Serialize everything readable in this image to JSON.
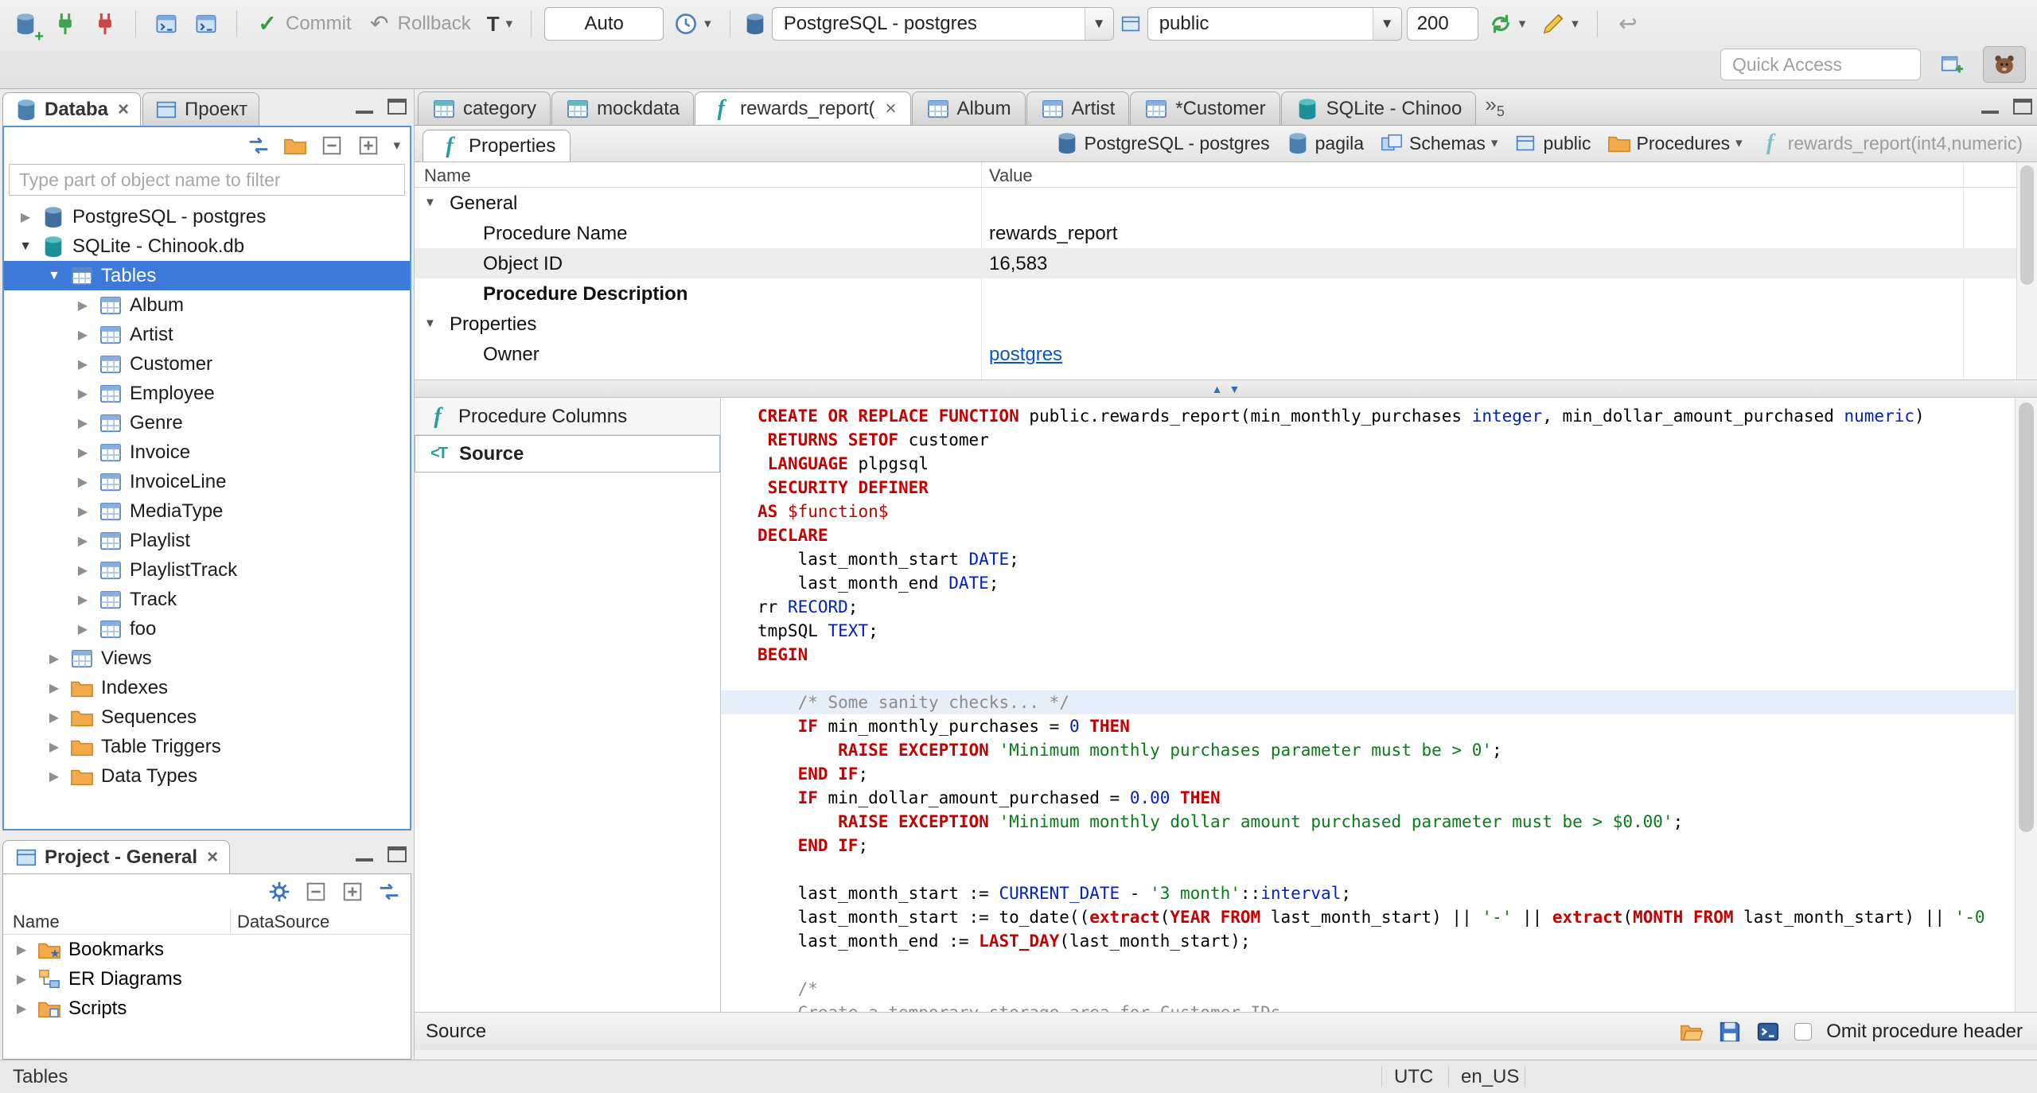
{
  "toolbar": {
    "commit_label": "Commit",
    "rollback_label": "Rollback",
    "txn_letter": "T",
    "auto_value": "Auto",
    "connection_value": "PostgreSQL - postgres",
    "schema_value": "public",
    "fetch_size": "200",
    "quick_access_placeholder": "Quick Access"
  },
  "navigator": {
    "tabs": [
      {
        "label": "Databa",
        "active": true,
        "icon": "db-plain"
      },
      {
        "label": "Проект",
        "active": false,
        "icon": "projects"
      }
    ],
    "filter_placeholder": "Type part of object name to filter",
    "tree": [
      {
        "label": "PostgreSQL - postgres",
        "indent": 0,
        "tw": "right",
        "icon": "db-pg"
      },
      {
        "label": "SQLite - Chinook.db",
        "indent": 0,
        "tw": "down",
        "icon": "db-teal"
      },
      {
        "label": "Tables",
        "indent": 1,
        "tw": "down",
        "icon": "tables",
        "selected": true
      },
      {
        "label": "Album",
        "indent": 2,
        "tw": "right",
        "icon": "table"
      },
      {
        "label": "Artist",
        "indent": 2,
        "tw": "right",
        "icon": "table"
      },
      {
        "label": "Customer",
        "indent": 2,
        "tw": "right",
        "icon": "table"
      },
      {
        "label": "Employee",
        "indent": 2,
        "tw": "right",
        "icon": "table"
      },
      {
        "label": "Genre",
        "indent": 2,
        "tw": "right",
        "icon": "table"
      },
      {
        "label": "Invoice",
        "indent": 2,
        "tw": "right",
        "icon": "table"
      },
      {
        "label": "InvoiceLine",
        "indent": 2,
        "tw": "right",
        "icon": "table"
      },
      {
        "label": "MediaType",
        "indent": 2,
        "tw": "right",
        "icon": "table"
      },
      {
        "label": "Playlist",
        "indent": 2,
        "tw": "right",
        "icon": "table"
      },
      {
        "label": "PlaylistTrack",
        "indent": 2,
        "tw": "right",
        "icon": "table"
      },
      {
        "label": "Track",
        "indent": 2,
        "tw": "right",
        "icon": "table"
      },
      {
        "label": "foo",
        "indent": 2,
        "tw": "right",
        "icon": "table"
      },
      {
        "label": "Views",
        "indent": 1,
        "tw": "right",
        "icon": "views"
      },
      {
        "label": "Indexes",
        "indent": 1,
        "tw": "right",
        "icon": "folder"
      },
      {
        "label": "Sequences",
        "indent": 1,
        "tw": "right",
        "icon": "folder"
      },
      {
        "label": "Table Triggers",
        "indent": 1,
        "tw": "right",
        "icon": "folder"
      },
      {
        "label": "Data Types",
        "indent": 1,
        "tw": "right",
        "icon": "folder"
      }
    ]
  },
  "project_panel": {
    "title": "Project - General",
    "columns": [
      "Name",
      "DataSource"
    ],
    "items": [
      {
        "label": "Bookmarks",
        "icon": "folder-star"
      },
      {
        "label": "ER Diagrams",
        "icon": "diagram"
      },
      {
        "label": "Scripts",
        "icon": "folder-script"
      }
    ]
  },
  "editor": {
    "tabs": [
      {
        "label": "category",
        "icon": "table-teal"
      },
      {
        "label": "mockdata",
        "icon": "table-teal"
      },
      {
        "label": "rewards_report(",
        "icon": "function",
        "active": true,
        "closable": true
      },
      {
        "label": "Album",
        "icon": "table"
      },
      {
        "label": "Artist",
        "icon": "table"
      },
      {
        "label": "*Customer",
        "icon": "table"
      },
      {
        "label": "SQLite - Chinoo",
        "icon": "db-teal"
      }
    ],
    "overflow_count": "5",
    "properties_tab_label": "Properties",
    "breadcrumbs": [
      {
        "label": "PostgreSQL - postgres",
        "icon": "db-pg"
      },
      {
        "label": "pagila",
        "icon": "db-plain"
      },
      {
        "label": "Schemas",
        "icon": "schemas",
        "dropdown": true
      },
      {
        "label": "public",
        "icon": "schema"
      },
      {
        "label": "Procedures",
        "icon": "folder",
        "dropdown": true
      },
      {
        "label": "rewards_report(int4,numeric)",
        "icon": "function",
        "muted": true
      }
    ],
    "grid": {
      "name_header": "Name",
      "value_header": "Value",
      "rows": [
        {
          "kind": "group",
          "name": "General"
        },
        {
          "kind": "prop",
          "name": "Procedure Name",
          "value": "rewards_report"
        },
        {
          "kind": "prop",
          "name": "Object ID",
          "value": "16,583",
          "shaded": true
        },
        {
          "kind": "prop",
          "name": "Procedure Description",
          "bold": true
        },
        {
          "kind": "group",
          "name": "Properties"
        },
        {
          "kind": "prop",
          "name": "Owner",
          "value": "postgres",
          "link": true
        }
      ]
    },
    "side_tabs": [
      {
        "label": "Procedure Columns",
        "icon": "function"
      },
      {
        "label": "Source",
        "icon": "source",
        "selected": true
      }
    ],
    "bottom": {
      "left_label": "Source",
      "checkbox_label": "Omit procedure header"
    }
  },
  "code": {
    "lines": [
      {
        "seg": [
          [
            "k",
            "CREATE OR REPLACE FUNCTION"
          ],
          [
            "p",
            " public.rewards_report(min_monthly_purchases "
          ],
          [
            "t",
            "integer"
          ],
          [
            "p",
            ", min_dollar_amount_purchased "
          ],
          [
            "t",
            "numeric"
          ],
          [
            "p",
            ")"
          ]
        ]
      },
      {
        "seg": [
          [
            "p",
            " "
          ],
          [
            "k",
            "RETURNS SETOF"
          ],
          [
            "p",
            " customer"
          ]
        ]
      },
      {
        "seg": [
          [
            "p",
            " "
          ],
          [
            "k",
            "LANGUAGE"
          ],
          [
            "p",
            " plpgsql"
          ]
        ]
      },
      {
        "seg": [
          [
            "p",
            " "
          ],
          [
            "k",
            "SECURITY DEFINER"
          ]
        ]
      },
      {
        "seg": [
          [
            "k",
            "AS"
          ],
          [
            "p",
            " "
          ],
          [
            "d",
            "$function$"
          ]
        ]
      },
      {
        "seg": [
          [
            "k",
            "DECLARE"
          ]
        ]
      },
      {
        "seg": [
          [
            "p",
            "    last_month_start "
          ],
          [
            "t",
            "DATE"
          ],
          [
            "p",
            ";"
          ]
        ]
      },
      {
        "seg": [
          [
            "p",
            "    last_month_end "
          ],
          [
            "t",
            "DATE"
          ],
          [
            "p",
            ";"
          ]
        ]
      },
      {
        "seg": [
          [
            "p",
            "rr "
          ],
          [
            "t",
            "RECORD"
          ],
          [
            "p",
            ";"
          ]
        ]
      },
      {
        "seg": [
          [
            "p",
            "tmpSQL "
          ],
          [
            "t",
            "TEXT"
          ],
          [
            "p",
            ";"
          ]
        ]
      },
      {
        "seg": [
          [
            "k",
            "BEGIN"
          ]
        ]
      },
      {
        "seg": []
      },
      {
        "hl": true,
        "seg": [
          [
            "p",
            "    "
          ],
          [
            "c",
            "/* Some sanity checks... */"
          ]
        ]
      },
      {
        "seg": [
          [
            "p",
            "    "
          ],
          [
            "k",
            "IF"
          ],
          [
            "p",
            " min_monthly_purchases = "
          ],
          [
            "n",
            "0"
          ],
          [
            "p",
            " "
          ],
          [
            "k",
            "THEN"
          ]
        ]
      },
      {
        "seg": [
          [
            "p",
            "        "
          ],
          [
            "k",
            "RAISE EXCEPTION"
          ],
          [
            "p",
            " "
          ],
          [
            "s",
            "'Minimum monthly purchases parameter must be > 0'"
          ],
          [
            "p",
            ";"
          ]
        ]
      },
      {
        "seg": [
          [
            "p",
            "    "
          ],
          [
            "k",
            "END IF"
          ],
          [
            "p",
            ";"
          ]
        ]
      },
      {
        "seg": [
          [
            "p",
            "    "
          ],
          [
            "k",
            "IF"
          ],
          [
            "p",
            " min_dollar_amount_purchased = "
          ],
          [
            "n",
            "0.00"
          ],
          [
            "p",
            " "
          ],
          [
            "k",
            "THEN"
          ]
        ]
      },
      {
        "seg": [
          [
            "p",
            "        "
          ],
          [
            "k",
            "RAISE EXCEPTION"
          ],
          [
            "p",
            " "
          ],
          [
            "s",
            "'Minimum monthly dollar amount purchased parameter must be > $0.00'"
          ],
          [
            "p",
            ";"
          ]
        ]
      },
      {
        "seg": [
          [
            "p",
            "    "
          ],
          [
            "k",
            "END IF"
          ],
          [
            "p",
            ";"
          ]
        ]
      },
      {
        "seg": []
      },
      {
        "seg": [
          [
            "p",
            "    last_month_start := "
          ],
          [
            "t",
            "CURRENT_DATE"
          ],
          [
            "p",
            " - "
          ],
          [
            "s",
            "'3 month'"
          ],
          [
            "p",
            "::"
          ],
          [
            "t",
            "interval"
          ],
          [
            "p",
            ";"
          ]
        ]
      },
      {
        "seg": [
          [
            "p",
            "    last_month_start := to_date(("
          ],
          [
            "k",
            "extract"
          ],
          [
            "p",
            "("
          ],
          [
            "k",
            "YEAR FROM"
          ],
          [
            "p",
            " last_month_start) || "
          ],
          [
            "s",
            "'-'"
          ],
          [
            "p",
            " || "
          ],
          [
            "k",
            "extract"
          ],
          [
            "p",
            "("
          ],
          [
            "k",
            "MONTH FROM"
          ],
          [
            "p",
            " last_month_start) || "
          ],
          [
            "s",
            "'-0"
          ]
        ]
      },
      {
        "seg": [
          [
            "p",
            "    last_month_end := "
          ],
          [
            "k",
            "LAST_DAY"
          ],
          [
            "p",
            "(last_month_start);"
          ]
        ]
      },
      {
        "seg": []
      },
      {
        "seg": [
          [
            "p",
            "    "
          ],
          [
            "c",
            "/*"
          ]
        ]
      },
      {
        "seg": [
          [
            "p",
            "    "
          ],
          [
            "c",
            "Create a temporary storage area for Customer IDs."
          ]
        ]
      },
      {
        "seg": [
          [
            "p",
            "    "
          ],
          [
            "c",
            "*/"
          ]
        ]
      }
    ]
  },
  "statusbar": {
    "left": "Tables",
    "timezone": "UTC",
    "locale": "en_US"
  }
}
